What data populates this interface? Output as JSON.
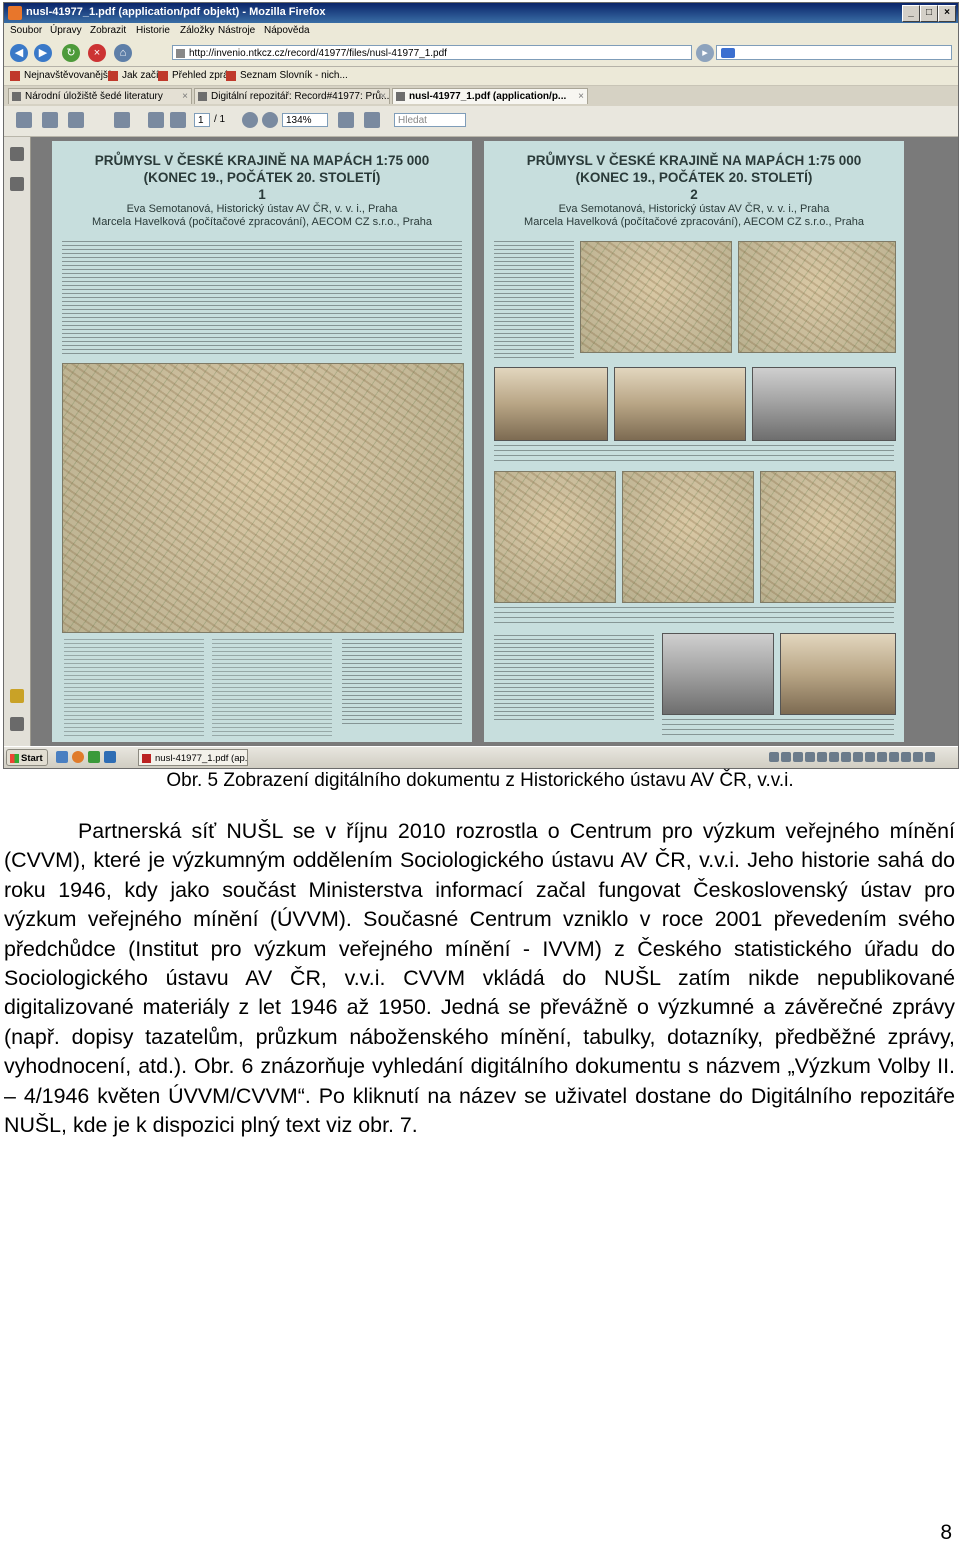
{
  "browser": {
    "window_title": "nusl-41977_1.pdf (application/pdf objekt) - Mozilla Firefox",
    "menu": [
      "Soubor",
      "Úpravy",
      "Zobrazit",
      "Historie",
      "Záložky",
      "Nástroje",
      "Nápověda"
    ],
    "url": "http://invenio.ntkcz.cz/record/41977/files/nusl-41977_1.pdf",
    "bookmarks": [
      "Nejnavštěvovanější",
      "Jak začít",
      "Přehled zpráv",
      "Seznam Slovník - nich..."
    ],
    "tabs": [
      {
        "label": "Národní úložiště šedé literatury",
        "active": false
      },
      {
        "label": "Digitální repozitář: Record#41977: Prů...",
        "active": false
      },
      {
        "label": "nusl-41977_1.pdf (application/p...",
        "active": true
      }
    ],
    "pdf_toolbar": {
      "page": "1",
      "page_total": "/ 1",
      "zoom": "134%",
      "search_placeholder": "Hledat"
    },
    "taskbar": {
      "start": "Start",
      "task": "nusl-41977_1.pdf (ap..."
    }
  },
  "poster": [
    {
      "title_line1": "PRŮMYSL V ČESKÉ KRAJINĚ NA MAPÁCH 1:75 000",
      "title_line2": "(KONEC 19., POČÁTEK 20. STOLETÍ)",
      "number": "1",
      "authors_line1": "Eva Semotanová, Historický ústav AV ČR, v. v. i., Praha",
      "authors_line2": "Marcela Havelková (počítačové zpracování), AECOM CZ s.r.o., Praha"
    },
    {
      "title_line1": "PRŮMYSL V ČESKÉ KRAJINĚ NA MAPÁCH 1:75 000",
      "title_line2": "(KONEC 19., POČÁTEK 20. STOLETÍ)",
      "number": "2",
      "authors_line1": "Eva Semotanová, Historický ústav AV ČR, v. v. i., Praha",
      "authors_line2": "Marcela Havelková (počítačové zpracování), AECOM CZ s.r.o., Praha"
    }
  ],
  "document": {
    "figure_caption": "Obr. 5 Zobrazení digitálního dokumentu z Historického ústavu AV ČR, v.v.i.",
    "paragraph": "Partnerská síť NUŠL se v říjnu 2010 rozrostla o Centrum pro výzkum veřejného mínění (CVVM), které je výzkumným oddělením Sociologického ústavu AV ČR, v.v.i. Jeho historie sahá do roku 1946, kdy jako součást Ministerstva informací začal fungovat Československý ústav pro výzkum veřejného mínění (ÚVVM). Současné Centrum vzniklo v roce 2001 převedením svého předchůdce (Institut pro výzkum veřejného mínění - IVVM) z Českého statistického úřadu do Sociologického ústavu AV ČR, v.v.i. CVVM vkládá do NUŠL zatím nikde nepublikované digitalizované materiály z let 1946 až 1950. Jedná se převážně o výzkumné a závěrečné zprávy (např. dopisy tazatelům, průzkum náboženského mínění, tabulky, dotazníky, předběžné zprávy, vyhodnocení, atd.). Obr. 6 znázorňuje vyhledání digitálního dokumentu s názvem „Výzkum Volby II. – 4/1946 květen ÚVVM/CVVM“. Po kliknutí na název se uživatel dostane do Digitálního repozitáře NUŠL, kde je k dispozici plný text viz obr. 7.",
    "page_number": "8"
  }
}
